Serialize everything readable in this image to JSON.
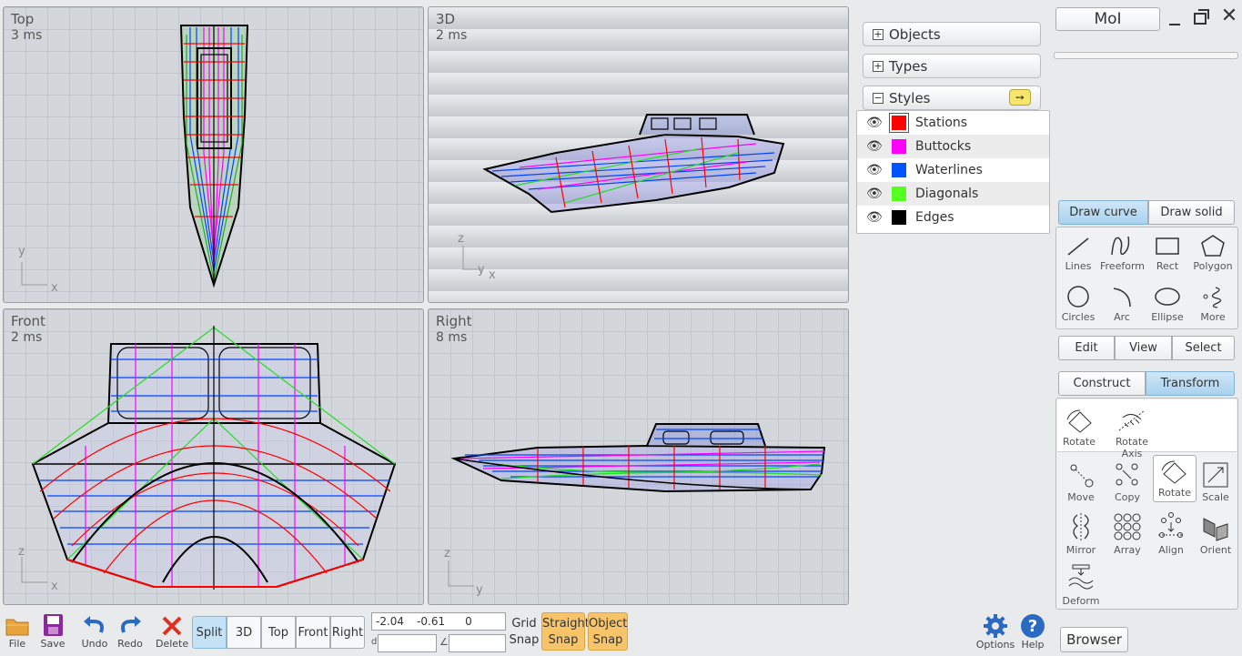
{
  "viewports": {
    "top": {
      "label": "Top",
      "ms": "3 ms",
      "axis_x": "x",
      "axis_y": "y"
    },
    "persp": {
      "label": "3D",
      "ms": "2 ms",
      "axis_x": "x",
      "axis_y": "y",
      "axis_z": "z"
    },
    "front": {
      "label": "Front",
      "ms": "2 ms",
      "axis_x": "x",
      "axis_z": "z"
    },
    "right": {
      "label": "Right",
      "ms": "8 ms",
      "axis_y": "y",
      "axis_z": "z"
    }
  },
  "panels": {
    "objects": "Objects",
    "types": "Types",
    "styles": "Styles"
  },
  "styles": [
    {
      "name": "Stations",
      "color": "#ff0000"
    },
    {
      "name": "Buttocks",
      "color": "#ff00ff"
    },
    {
      "name": "Waterlines",
      "color": "#0055ff"
    },
    {
      "name": "Diagonals",
      "color": "#55ff22"
    },
    {
      "name": "Edges",
      "color": "#000000"
    }
  ],
  "moi": {
    "label": "MoI"
  },
  "draw_tabs": {
    "curve": "Draw curve",
    "solid": "Draw solid"
  },
  "draw_tools": {
    "lines": "Lines",
    "freeform": "Freeform",
    "rect": "Rect",
    "polygon": "Polygon",
    "circles": "Circles",
    "arc": "Arc",
    "ellipse": "Ellipse",
    "more": "More"
  },
  "mid_tabs": {
    "edit": "Edit",
    "view": "View",
    "select": "Select"
  },
  "xform_tabs": {
    "construct": "Construct",
    "transform": "Transform"
  },
  "rotate_tools": {
    "rotate": "Rotate",
    "rotate_axis": "Rotate Axis"
  },
  "transform_tools": {
    "move": "Move",
    "copy": "Copy",
    "rotate": "Rotate",
    "scale": "Scale",
    "mirror": "Mirror",
    "array": "Array",
    "align": "Align",
    "orient": "Orient",
    "deform": "Deform"
  },
  "bottom": {
    "file": "File",
    "save": "Save",
    "undo": "Undo",
    "redo": "Redo",
    "delete": "Delete",
    "views": {
      "split": "Split",
      "three_d": "3D",
      "top": "Top",
      "front": "Front",
      "right": "Right"
    },
    "coords": {
      "x": "-2.04",
      "y": "-0.61",
      "z": "0"
    },
    "d_label": "d",
    "angle_label": "∠",
    "grid_snap": {
      "line1": "Grid",
      "line2": "Snap"
    },
    "straight_snap": {
      "line1": "Straight",
      "line2": "Snap"
    },
    "object_snap": {
      "line1": "Object",
      "line2": "Snap"
    },
    "options": "Options",
    "help": "Help",
    "browser": "Browser"
  },
  "accent": "#a9d2ef",
  "snap_color": "#f7c46a"
}
